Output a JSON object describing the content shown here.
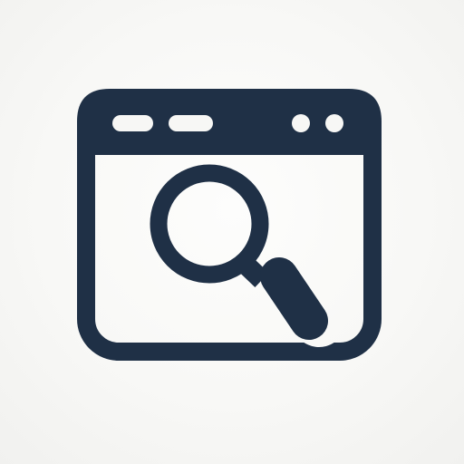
{
  "icon": {
    "name": "browser-search-icon",
    "color": "#1f3046",
    "background": "#f7f7f5",
    "parts": [
      "browser-window-frame",
      "window-title-bar",
      "control-pill-left",
      "control-pill-right",
      "control-dot-left",
      "control-dot-right",
      "magnifier-lens-ring",
      "magnifier-handle"
    ]
  }
}
